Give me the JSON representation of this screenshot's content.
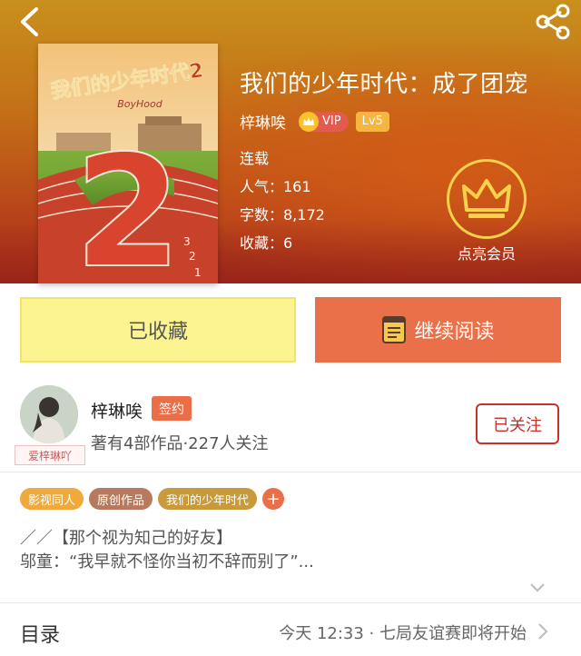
{
  "colors": {
    "header_gradient_top": "#c8901c",
    "header_gradient_bottom": "#a9301d",
    "collected_button_bg": "#fcf491",
    "read_button_bg": "#e97048",
    "follow_button_border": "#c9302c",
    "sign_badge": "#ea6e47",
    "member_crown": "#f7d24a"
  },
  "header": {
    "back_icon": "chevron-left-icon",
    "share_icon": "share-icon"
  },
  "cover": {
    "title_art": "我们的少年时代2",
    "subtitle_art": "BoyHood",
    "track_number": "2",
    "lane_numbers": [
      "1",
      "2",
      "3"
    ]
  },
  "book": {
    "title": "我们的少年时代：成了团宠",
    "author": "梓琳唉",
    "vip_label": "VIP",
    "level_label": "Lv5",
    "status": "连载",
    "popularity": "人气：161",
    "word_count": "字数：8,172",
    "favorites": "收藏：6"
  },
  "member": {
    "icon": "crown-icon",
    "label": "点亮会员"
  },
  "actions": {
    "collected_label": "已收藏",
    "read_label": "继续阅读",
    "read_icon": "book-icon"
  },
  "author_section": {
    "avatar_tag": "爱梓琳吖",
    "name": "梓琳唉",
    "sign_label": "签约",
    "stats": "著有4部作品·227人关注",
    "follow_label": "已关注"
  },
  "tags": [
    {
      "label": "影视同人",
      "color": "#f0a93b"
    },
    {
      "label": "原创作品",
      "color": "#b87a5f"
    },
    {
      "label": "我们的少年时代",
      "color": "#c99a3a"
    }
  ],
  "tag_add_label": "+",
  "intro": {
    "line1": "／／【那个视为知己的好友】",
    "line2": "邬童：“我早就不怪你当初不辞而别了”..."
  },
  "toc": {
    "label": "目录",
    "latest": "今天 12:33 · 七局友谊赛即将开始"
  }
}
